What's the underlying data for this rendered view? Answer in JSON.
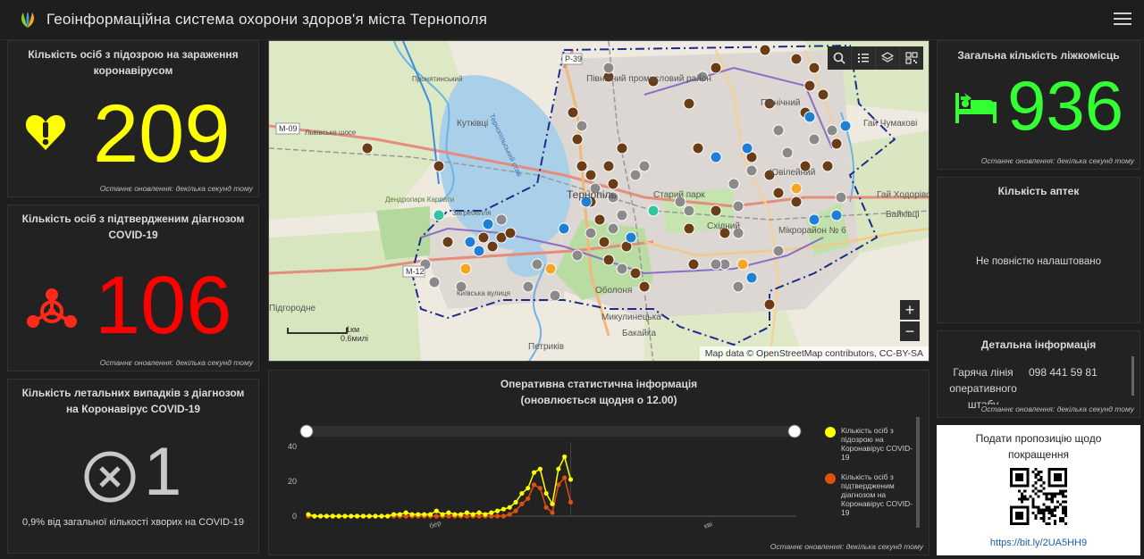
{
  "header": {
    "title": "Геоінформаційна система охорони здоров'я міста Тернополя",
    "logo_icon": "leaf-logo-icon",
    "menu_icon": "hamburger-menu-icon"
  },
  "suspected": {
    "title": "Кількість осіб з підозрою на зараження коронавірусом",
    "value": "209",
    "color": "#ffff00",
    "icon": "heart-exclamation-icon",
    "footer": "Останнє оновлення: декілька секунд тому"
  },
  "confirmed": {
    "title": "Кількість осіб з підтвердженим діагнозом COVID-19",
    "value": "106",
    "color": "#ff0000",
    "icon": "biohazard-icon",
    "footer": "Останнє оновлення: декілька секунд тому"
  },
  "deaths": {
    "title": "Кількість летальних випадків з діагнозом на Коронавірус COVID-19",
    "value": "1",
    "color": "#c8c8c8",
    "icon": "circle-x-icon",
    "subtitle": "0,9% від загальної кількості хворих на COVID-19"
  },
  "map": {
    "attribution": "Map data © OpenStreetMap contributors, CC-BY-SA",
    "scale_km": "1км",
    "scale_mi": "0.6милі",
    "tools": [
      "search-icon",
      "list-icon",
      "layers-icon",
      "qr-icon"
    ],
    "zoom_in": "+",
    "zoom_out": "−",
    "labels": {
      "pidvolochysk": "Підволочиськ",
      "ternopil": "Тернопіль",
      "sryi_park": "Старий парк",
      "skhidnyi": "Східний",
      "pivnichnyi": "Північний",
      "promysl": "Північний промисловий район",
      "kutkivtsi": "Кутківці",
      "obolon": "Оболоня",
      "petrykiv": "Петриків",
      "bakaika": "Бакайка",
      "mykulynetska": "Микулинецька",
      "hai_chumakovi": "Гай Чумакові",
      "hai_khodor": "Гай Ходорівс",
      "baikivtsi": "Байківці",
      "mikroraion": "Мікрорайон № 6",
      "m09": "M-09",
      "m12": "M-12",
      "p39": "P-39",
      "dendropark": "Дендропарк Карпати",
      "zagrebelia": "Загребелля",
      "pronyatyn": "Пронятинський",
      "pidgorodne": "Підгородне",
      "yuvileinyi": "Ювілейний",
      "lvivske": "Львівське шосе",
      "kyivska": "Київська вулиця",
      "lake": "Тернопільський став"
    }
  },
  "chart": {
    "title_line1": "Оперативна статистична інформація",
    "title_line2": "(оновлюється щодня о 12.00)",
    "footer": "Останнє оновлення: декілька секунд тому"
  },
  "chart_data": {
    "type": "line",
    "xlabel": "",
    "ylabel": "",
    "x_tick_labels": [
      "бер",
      "кві"
    ],
    "yticks": [
      0,
      20,
      40
    ],
    "ylim": [
      0,
      45
    ],
    "series": [
      {
        "name": "Кількість осіб з підозрою на Коронавірус COVID-19",
        "color": "#ffff00",
        "values": [
          1,
          0,
          0,
          0,
          0,
          0,
          0,
          0,
          0,
          0,
          0,
          0,
          0,
          0,
          1,
          1,
          2,
          1,
          1,
          1,
          1,
          3,
          1,
          2,
          1,
          1,
          2,
          1,
          2,
          1,
          2,
          3,
          4,
          5,
          8,
          13,
          16,
          25,
          27,
          13,
          7,
          27,
          34,
          21
        ]
      },
      {
        "name": "Кількість осіб з підтвердженим діагнозом на Коронавірус COVID-19",
        "color": "#e0520c",
        "values": [
          0,
          0,
          0,
          0,
          0,
          0,
          0,
          0,
          0,
          0,
          0,
          0,
          0,
          0,
          0,
          0,
          0,
          0,
          0,
          0,
          0,
          0,
          0,
          0,
          0,
          0,
          0,
          0,
          0,
          0,
          0,
          0,
          0,
          1,
          3,
          7,
          10,
          18,
          16,
          5,
          2,
          18,
          22,
          8
        ]
      }
    ]
  },
  "legend": {
    "suspected": "Кількість осіб з підозрою на Коронавірус COVID-19",
    "confirmed": "Кількість осіб з підтвердженим діагнозом на Коронавірус COVID-19"
  },
  "beds": {
    "title": "Загальна кількість ліжкомісць",
    "value": "936",
    "color": "#33ff33",
    "icon": "hospital-bed-icon",
    "footer": "Останнє оновлення: декілька секунд тому"
  },
  "pharmacies": {
    "title": "Кількість аптек",
    "message": "Не повністю налаштовано"
  },
  "details": {
    "title": "Детальна інформація",
    "hotline_label_1": "Гаряча лінія",
    "phone": "098 441 59 81",
    "hotline_label_2": "оперативного",
    "hotline_label_3": "штабу",
    "footer": "Останнє оновлення: декілька секунд тому"
  },
  "feedback": {
    "title": "Подати пропозицію щодо покращення",
    "link": "https://bit.ly/2UA5HH9"
  }
}
